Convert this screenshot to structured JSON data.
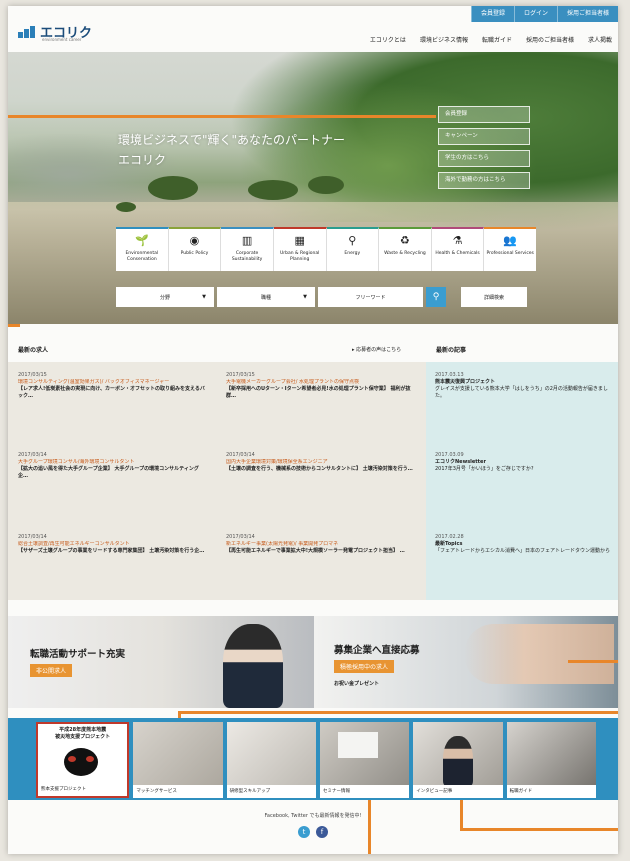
{
  "header": {
    "top_links": [
      "会員登録",
      "ログイン",
      "採用ご担当者様"
    ],
    "logo_text": "エコリク",
    "logo_sub": "environment career",
    "nav": [
      "エコリクとは",
      "環境ビジネス情報",
      "転職ガイド",
      "採用のご担当者様",
      "求人掲載"
    ]
  },
  "hero": {
    "title_line1": "環境ビジネスで\"輝く\"あなたのパートナー",
    "title_line2": "エコリク",
    "quick_links": [
      "会員登録",
      "キャンペーン",
      "学生の方はこちら",
      "海外で勤務の方はこちら"
    ]
  },
  "categories": [
    {
      "icon": "plant-icon",
      "glyph": "🌱",
      "label": "Environmental Conservation"
    },
    {
      "icon": "globe-icon",
      "glyph": "◉",
      "label": "Public Policy"
    },
    {
      "icon": "factory-icon",
      "glyph": "▥",
      "label": "Corporate Sustainability"
    },
    {
      "icon": "building-icon",
      "glyph": "▦",
      "label": "Urban & Regional Planning"
    },
    {
      "icon": "wind-turbine-icon",
      "glyph": "⚲",
      "label": "Energy"
    },
    {
      "icon": "recycle-icon",
      "glyph": "♻",
      "label": "Waste & Recycling"
    },
    {
      "icon": "flask-icon",
      "glyph": "⚗",
      "label": "Health & Chemicals"
    },
    {
      "icon": "people-icon",
      "glyph": "👥",
      "label": "Professional Services"
    }
  ],
  "search": {
    "field1": "分野",
    "field2": "職種",
    "keyword": "フリーワード",
    "advanced": "詳細検索"
  },
  "jobs_section": {
    "title": "最新の求人",
    "link": "応募者の声はこちら",
    "items": [
      {
        "date": "2017/03/15",
        "company": "環境コンサルティング(温室効果ガス)/ バックオフィスマネージャー",
        "text": "【レア求人!低炭素社会の実現に向け、カーボン・オフセットの取り組みを支えるバック…"
      },
      {
        "date": "2017/03/15",
        "company": "大手電機メーカーグループ会社/ 水処理プラントの保守点検",
        "text": "【新卒採用へのUターン・Iターン希望者必見!水の処理プラント保守業】 福利が抜群…"
      },
      {
        "date": "2017/03/14",
        "company": "大手グループ環境コンサル/海外環境コンサルタント",
        "text": "【拡大の追い風を得た大手グループ企業】 大手グループの環境コンサルティング企…"
      },
      {
        "date": "2017/03/14",
        "company": "国内大手企業環境対策/環境保全系エンジニア",
        "text": "【土壌の調査を行う、機械系の技術からコンサルタントに】 土壌汚染対策を行う…"
      },
      {
        "date": "2017/03/14",
        "company": "総合土壌調査/再生可能エネルギーコンサルタント",
        "text": "【サザーズ土壌グループの事業をリードする専門家集団】 土壌汚染対策を行う企…"
      },
      {
        "date": "2017/03/14",
        "company": "新エネルギー事業(太陽光発電)/ 事業開発プロマネ",
        "text": "【再生可能エネルギーで事業拡大中!大規模ソーラー発電プロジェクト担当】 …"
      }
    ]
  },
  "articles_section": {
    "title": "最新の記事",
    "items": [
      {
        "date": "2017.03.13",
        "category": "熊本震災復興プロジェクト",
        "text": "グレイスが支援している熊本大学「はしをうち」の2月の活動報告が届きました。"
      },
      {
        "date": "2017.03.09",
        "category": "エコリクNewsletter",
        "text": "2017年3月号「かいほう」をご存じですか?"
      },
      {
        "date": "2017.02.28",
        "category": "最新Topics",
        "text": "「フェアトレードからエシカル消費へ」日本のフェアトレードタウン運動から"
      }
    ]
  },
  "banners": {
    "left_title": "転職活動サポート充実",
    "left_badge": "非公開求人",
    "right_title": "募集企業へ直接応募",
    "right_badge": "積極採用中の求人",
    "right_sub": "お祝い金プレゼント"
  },
  "gallery": {
    "feature_heading_line1": "平成28年度熊本地震",
    "feature_heading_line2": "被災地支援プロジェクト",
    "items": [
      "熊本支援プロジェクト",
      "マッチングサービス",
      "研修型スキルアップ",
      "セミナー情報",
      "インタビュー記事",
      "転職ガイド"
    ]
  },
  "footer": {
    "social_text": "Facebook, Twitter でも最新情報を発信中!",
    "twitter": "twitter-icon",
    "facebook": "facebook-icon"
  },
  "colors": {
    "accent": "#3a8fc0",
    "orange": "#e8862a",
    "jobs_bg": "#ece9e1",
    "articles_bg": "#d9ecec"
  }
}
